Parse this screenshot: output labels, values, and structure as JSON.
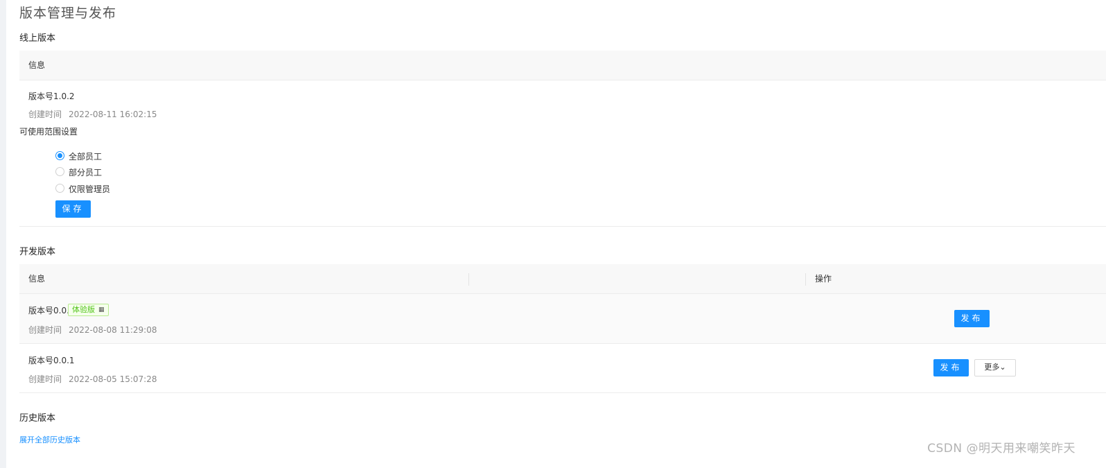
{
  "page_title": "版本管理与发布",
  "online": {
    "section_title": "线上版本",
    "column_info": "信息",
    "version": "版本号1.0.2",
    "created_label": "创建时间",
    "created_time": "2022-08-11 16:02:15",
    "scope_title": "可使用范围设置",
    "scope_options": [
      "全部员工",
      "部分员工",
      "仅限管理员"
    ],
    "scope_selected": "全部员工",
    "save_label": "保存"
  },
  "dev": {
    "section_title": "开发版本",
    "column_info": "信息",
    "column_action": "操作",
    "rows": [
      {
        "version": "版本号0.0.5",
        "tag": "体验版",
        "tag_icon": "qrcode-icon",
        "created_label": "创建时间",
        "created_time": "2022-08-08 11:29:08",
        "publish_label": "发布"
      },
      {
        "version": "版本号0.0.1",
        "created_label": "创建时间",
        "created_time": "2022-08-05 15:07:28",
        "publish_label": "发布",
        "more_label": "更多"
      }
    ]
  },
  "history": {
    "section_title": "历史版本",
    "expand_label": "展开全部历史版本"
  },
  "watermark": "CSDN @明天用来嘲笑昨天",
  "colors": {
    "primary": "#1890ff",
    "tag_green": "#52c41a",
    "header_bg": "#f8f8f8"
  }
}
